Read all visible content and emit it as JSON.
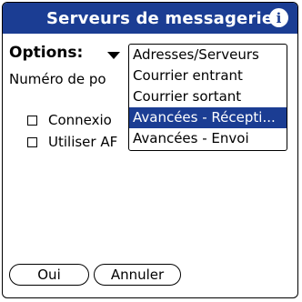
{
  "window": {
    "title": "Serveurs de messagerie",
    "info_icon": "i"
  },
  "options": {
    "label": "Options:"
  },
  "form": {
    "port_label": "Numéro de po",
    "checkbox1_label": "Connexio",
    "checkbox2_label": "Utiliser AF"
  },
  "dropdown": {
    "items": [
      {
        "label": "Adresses/Serveurs"
      },
      {
        "label": "Courrier entrant"
      },
      {
        "label": "Courrier sortant"
      },
      {
        "label": "Avancées - Récepti..."
      },
      {
        "label": "Avancées - Envoi"
      }
    ],
    "selected_index": 3
  },
  "buttons": {
    "ok_label": "Oui",
    "cancel_label": "Annuler"
  },
  "colors": {
    "title_bar": "#1b3d93",
    "selection": "#1b3d93"
  }
}
